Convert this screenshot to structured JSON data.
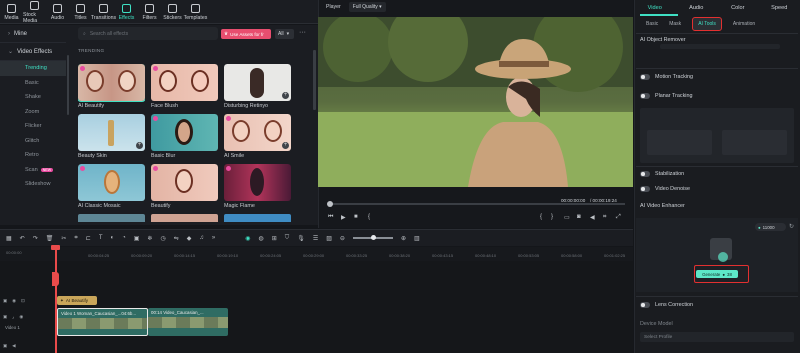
{
  "toolbar": {
    "items": [
      {
        "label": "Media",
        "icon": "media-icon"
      },
      {
        "label": "Stock Media",
        "icon": "stock-media-icon"
      },
      {
        "label": "Audio",
        "icon": "audio-icon"
      },
      {
        "label": "Titles",
        "icon": "titles-icon"
      },
      {
        "label": "Transitions",
        "icon": "transitions-icon"
      },
      {
        "label": "Effects",
        "icon": "effects-icon",
        "active": true
      },
      {
        "label": "Filters",
        "icon": "filters-icon"
      },
      {
        "label": "Stickers",
        "icon": "stickers-icon"
      },
      {
        "label": "Templates",
        "icon": "templates-icon"
      }
    ]
  },
  "sidebar": {
    "mine_label": "Mine",
    "video_effects_label": "Video Effects",
    "items": [
      "Trending",
      "Basic",
      "Shake",
      "Zoom",
      "Flicker",
      "Glitch",
      "Retro",
      "Scan",
      "Slideshow"
    ],
    "active_index": 0,
    "new_badge": "NEW"
  },
  "effects_panel": {
    "search_placeholder": "Search all effects",
    "use_assets_label": "Use Assets for fr",
    "filter_value": "All",
    "section_label": "TRENDING",
    "cards": [
      "AI Beautify",
      "Face Blush",
      "Disturbing Retinyo",
      "Beauty Skin",
      "Basic Blur",
      "AI Smile",
      "AI Classic Mosaic",
      "Beautify",
      "Magic Flame"
    ]
  },
  "player": {
    "label": "Player",
    "quality": "Full Quality",
    "current_time": "00:00:00:00",
    "total_time": "/ 00:00:19:24"
  },
  "right_panel": {
    "tabs": [
      "Video",
      "Audio",
      "Color",
      "Speed"
    ],
    "active_tab": "Video",
    "subtabs": [
      "Basic",
      "Mask",
      "AI Tools",
      "Animation"
    ],
    "active_subtab": "AI Tools",
    "ai_object_remover": "AI Object Remover",
    "motion_tracking": "Motion Tracking",
    "planar_tracking": "Planar Tracking",
    "stabilization": "Stabilization",
    "video_denoise": "Video Denoise",
    "ai_video_enhancer": "AI Video Enhancer",
    "credits": "11000",
    "generate_label": "Generate",
    "generate_cost": "38",
    "lens_correction": "Lens Correction",
    "device_model_label": "Device Model",
    "device_model_value": "Select Profile"
  },
  "timeline": {
    "ruler": [
      "00:00:00",
      "00:00:04:25",
      "00:00:09:20",
      "00:00:14:15",
      "00:00:19:10",
      "00:00:24:05",
      "00:00:29:00",
      "00:00:33:25",
      "00:00:38:20",
      "00:00:43:15",
      "00:00:48:10",
      "00:00:53:05",
      "00:00:58:00",
      "00:01:02:25"
    ],
    "fx_clip_label": "AI Beautify",
    "clip1_label": "Video 1 Woman_Caucasian_...04:6b...",
    "clip2_label": "00:14 Video_Caucasian_...",
    "track_label": "Video 1"
  },
  "colors": {
    "accent": "#3fe0c4",
    "highlight": "#e23030",
    "playhead": "#e94b4b"
  }
}
